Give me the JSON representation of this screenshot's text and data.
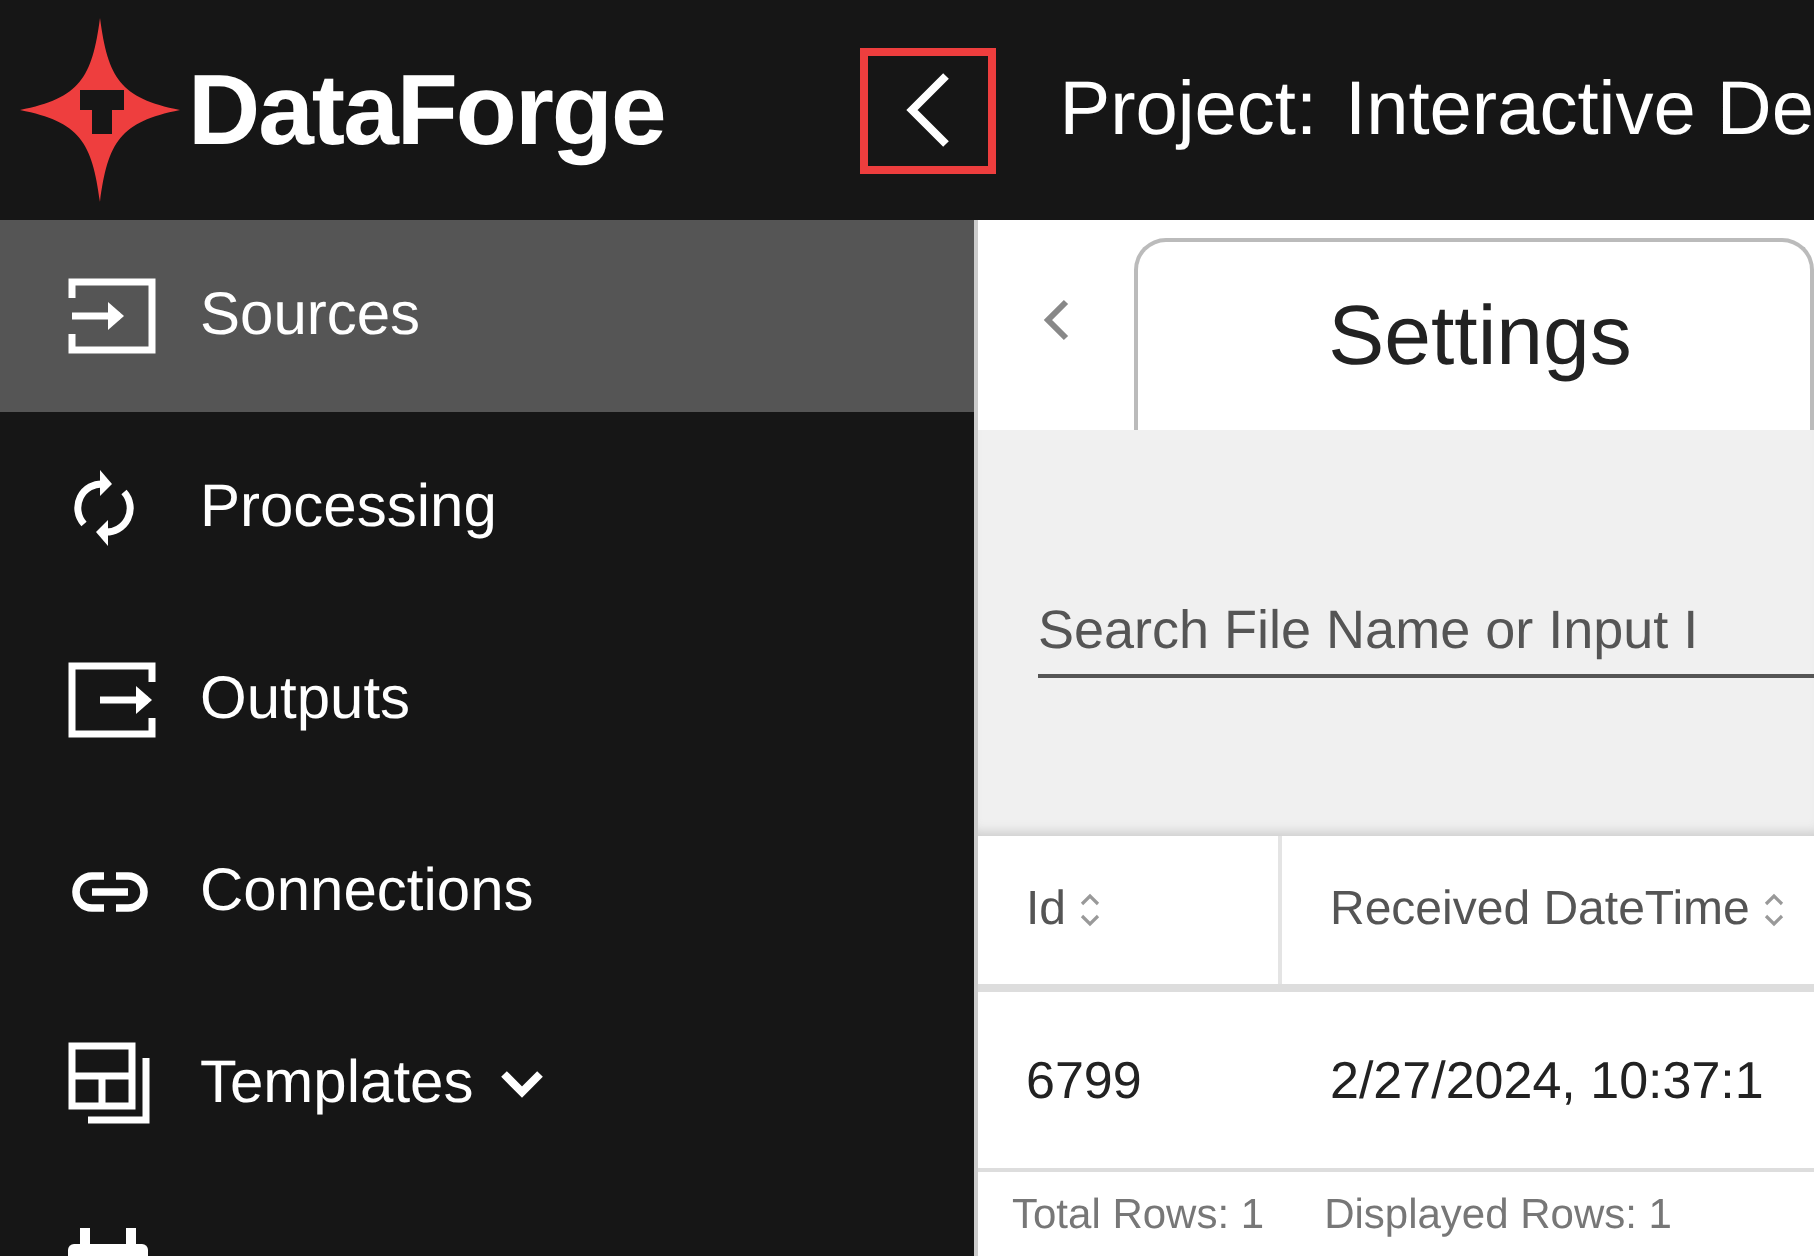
{
  "header": {
    "logo_text": "DataForge",
    "project_label": "Project:",
    "project_name": "Interactive De"
  },
  "sidebar": {
    "items": [
      {
        "kind": "input",
        "label": "Sources",
        "selected": true
      },
      {
        "kind": "sync",
        "label": "Processing",
        "selected": false
      },
      {
        "kind": "output",
        "label": "Outputs",
        "selected": false
      },
      {
        "kind": "link",
        "label": "Connections",
        "selected": false
      },
      {
        "kind": "template",
        "label": "Templates",
        "selected": false,
        "expanded": false
      },
      {
        "kind": "calendar",
        "selected": false
      }
    ]
  },
  "tabs": [
    {
      "label": "Settings",
      "selected": true
    }
  ],
  "search": {
    "placeholder": "Search File Name or Input I"
  },
  "table": {
    "columns": [
      "Id",
      "Received DateTime"
    ],
    "rows": [
      [
        "6799",
        "2/27/2024, 10:37:1"
      ]
    ]
  },
  "footer": {
    "total": "Total Rows: 1",
    "displayed": "Displayed Rows: 1"
  }
}
